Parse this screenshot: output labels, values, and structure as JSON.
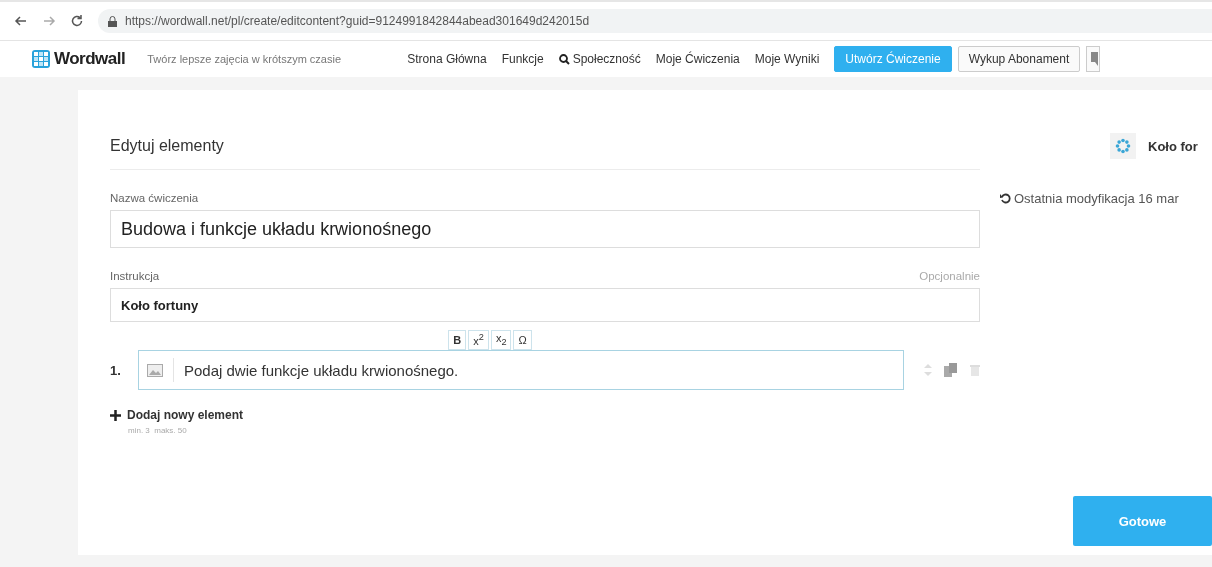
{
  "browser": {
    "url": "https://wordwall.net/pl/create/editcontent?guid=9124991842844abead301649d242015d"
  },
  "header": {
    "logo": "Wordwall",
    "tagline": "Twórz lepsze zajęcia w krótszym czasie",
    "nav": [
      {
        "label": "Strona Główna",
        "kind": "link"
      },
      {
        "label": "Funkcje",
        "kind": "link"
      },
      {
        "label": "Społeczność",
        "kind": "search"
      },
      {
        "label": "Moje Ćwiczenia",
        "kind": "link"
      },
      {
        "label": "Moje Wyniki",
        "kind": "link"
      }
    ],
    "buttons": [
      {
        "label": "Utwórz Ćwiczenie",
        "kind": "primary"
      },
      {
        "label": "Wykup Abonament",
        "kind": "secondary"
      }
    ]
  },
  "editor": {
    "title": "Edytuj elementy",
    "template": "Koło for",
    "last_modified": "Ostatnia modyfikacja 16 mar",
    "fields": [
      {
        "label": "Nazwa ćwiczenia",
        "value": "Budowa i funkcje układu krwionośnego",
        "kind": "title"
      },
      {
        "label": "Instrukcja",
        "hint": "Opcjonalnie",
        "value": "Koło fortuny",
        "kind": "text"
      }
    ],
    "toolbar": [
      "B",
      "x$^{2}$",
      "x$_{2}$",
      "Ω"
    ],
    "items": [
      {
        "number": "1.",
        "text": "Podaj dwie funkcje układu krwionośnego."
      }
    ],
    "add_label": "Dodaj nowy element",
    "limits": "min. 3  maks. 50",
    "done": "Gotowe"
  }
}
